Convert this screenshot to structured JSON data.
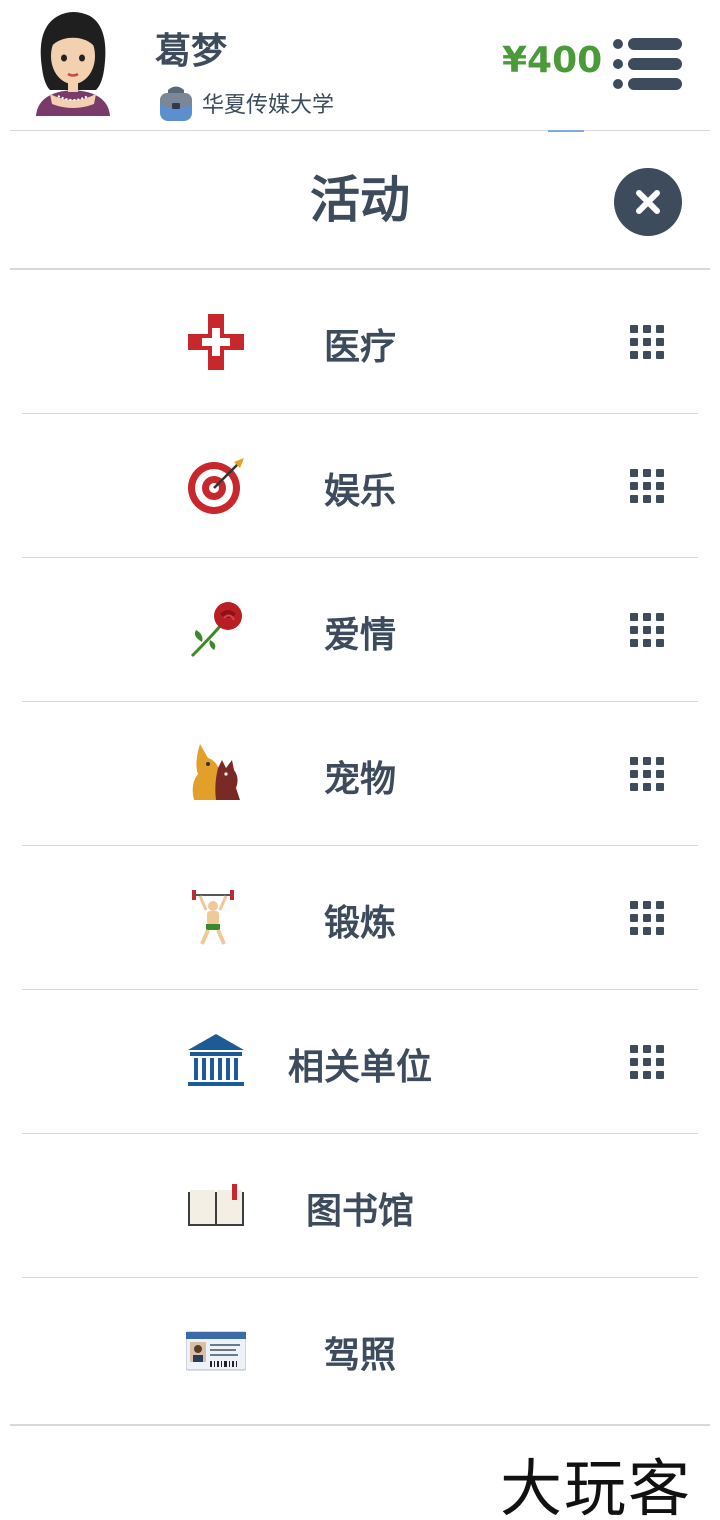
{
  "header": {
    "user_name": "葛梦",
    "school": "华夏传媒大学",
    "money": "¥400"
  },
  "dialog": {
    "title": "活动"
  },
  "items": [
    {
      "label": "医疗",
      "icon": "red-cross-icon",
      "has_grid": true
    },
    {
      "label": "娱乐",
      "icon": "dartboard-icon",
      "has_grid": true
    },
    {
      "label": "爱情",
      "icon": "rose-icon",
      "has_grid": true
    },
    {
      "label": "宠物",
      "icon": "dog-cat-icon",
      "has_grid": true
    },
    {
      "label": "锻炼",
      "icon": "weightlifter-icon",
      "has_grid": true
    },
    {
      "label": "相关单位",
      "icon": "government-building-icon",
      "has_grid": true
    },
    {
      "label": "图书馆",
      "icon": "open-book-icon",
      "has_grid": false
    },
    {
      "label": "驾照",
      "icon": "driver-license-icon",
      "has_grid": false
    }
  ],
  "watermark": "大玩客",
  "colors": {
    "text": "#3d4b5c",
    "money": "#4a9a3a",
    "divider": "#d8d8d8"
  }
}
